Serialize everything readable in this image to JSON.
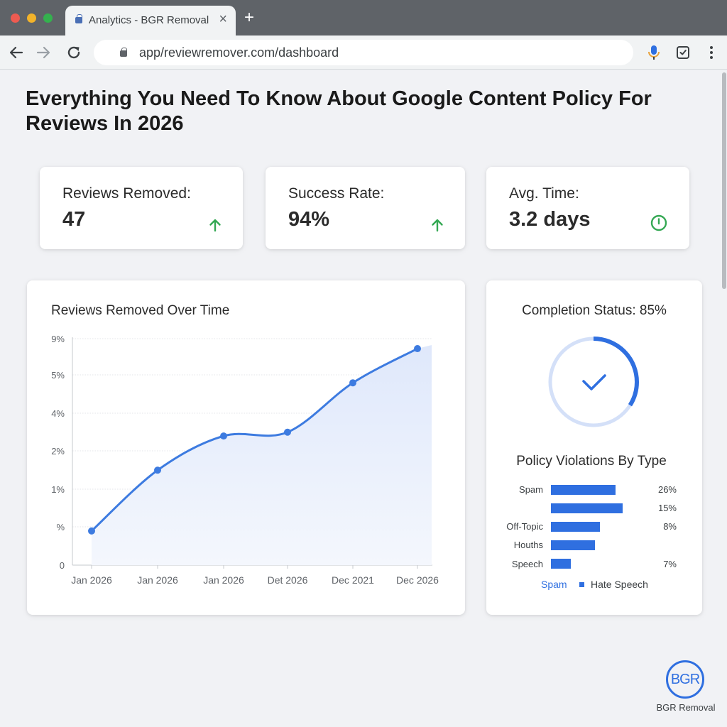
{
  "browser": {
    "tab_title": "Analytics - BGR Removal",
    "tab_close": "×",
    "new_tab": "+",
    "url": "app/reviewremover.com/dashboard"
  },
  "page": {
    "title": "Everything You Need To Know About Google Content Policy For Reviews In 2026"
  },
  "kpis": [
    {
      "label": "Reviews Removed:",
      "value": "47",
      "icon": "arrow-up-icon"
    },
    {
      "label": "Success Rate:",
      "value": "94%",
      "icon": "arrow-up-icon"
    },
    {
      "label": "Avg. Time:",
      "value": "3.2 days",
      "icon": "clock-icon"
    }
  ],
  "colors": {
    "accent": "#2f6fe0",
    "line": "#3d7be0",
    "up_green": "#34a853",
    "ring_track": "#d4e0f8"
  },
  "line_chart": {
    "title": "Reviews Removed Over Time",
    "y_ticks": [
      "9%",
      "5%",
      "4%",
      "2%",
      "1%",
      "%",
      "0"
    ],
    "x_ticks": [
      "Jan 2026",
      "Jan 2026",
      "Jan 2026",
      "Det 2026",
      "Dec 2021",
      "Dec 2026"
    ]
  },
  "chart_data": {
    "type": "area",
    "title": "Reviews Removed Over Time",
    "categories": [
      "Jan 2026",
      "Jan 2026",
      "Jan 2026",
      "Det 2026",
      "Dec 2021",
      "Dec 2026"
    ],
    "y_tick_labels": [
      "0",
      "%",
      "1%",
      "2%",
      "4%",
      "5%",
      "9%"
    ],
    "series": [
      {
        "values": [
          0.9,
          2.5,
          3.4,
          3.5,
          4.8,
          5.7
        ]
      }
    ],
    "ylim": [
      0,
      6
    ],
    "grid": true,
    "legend": "none"
  },
  "completion": {
    "title": "Completion Status: 85%",
    "fraction": 0.85,
    "icon": "check-icon"
  },
  "violations": {
    "title": "Policy Violations By Type",
    "rows": [
      {
        "label": "Spam",
        "pct": "26%",
        "level": 0.65
      },
      {
        "label": "",
        "pct": "15%",
        "level": 0.72
      },
      {
        "label": "Off-Topic",
        "pct": "8%",
        "level": 0.49
      },
      {
        "label": "Houths",
        "pct": "",
        "level": 0.44
      },
      {
        "label": "Speech",
        "pct": "7%",
        "level": 0.2
      }
    ],
    "legend": [
      "Spam",
      "Hate Speech"
    ]
  },
  "brand": {
    "mark": "BGR",
    "name": "BGR Removal"
  }
}
